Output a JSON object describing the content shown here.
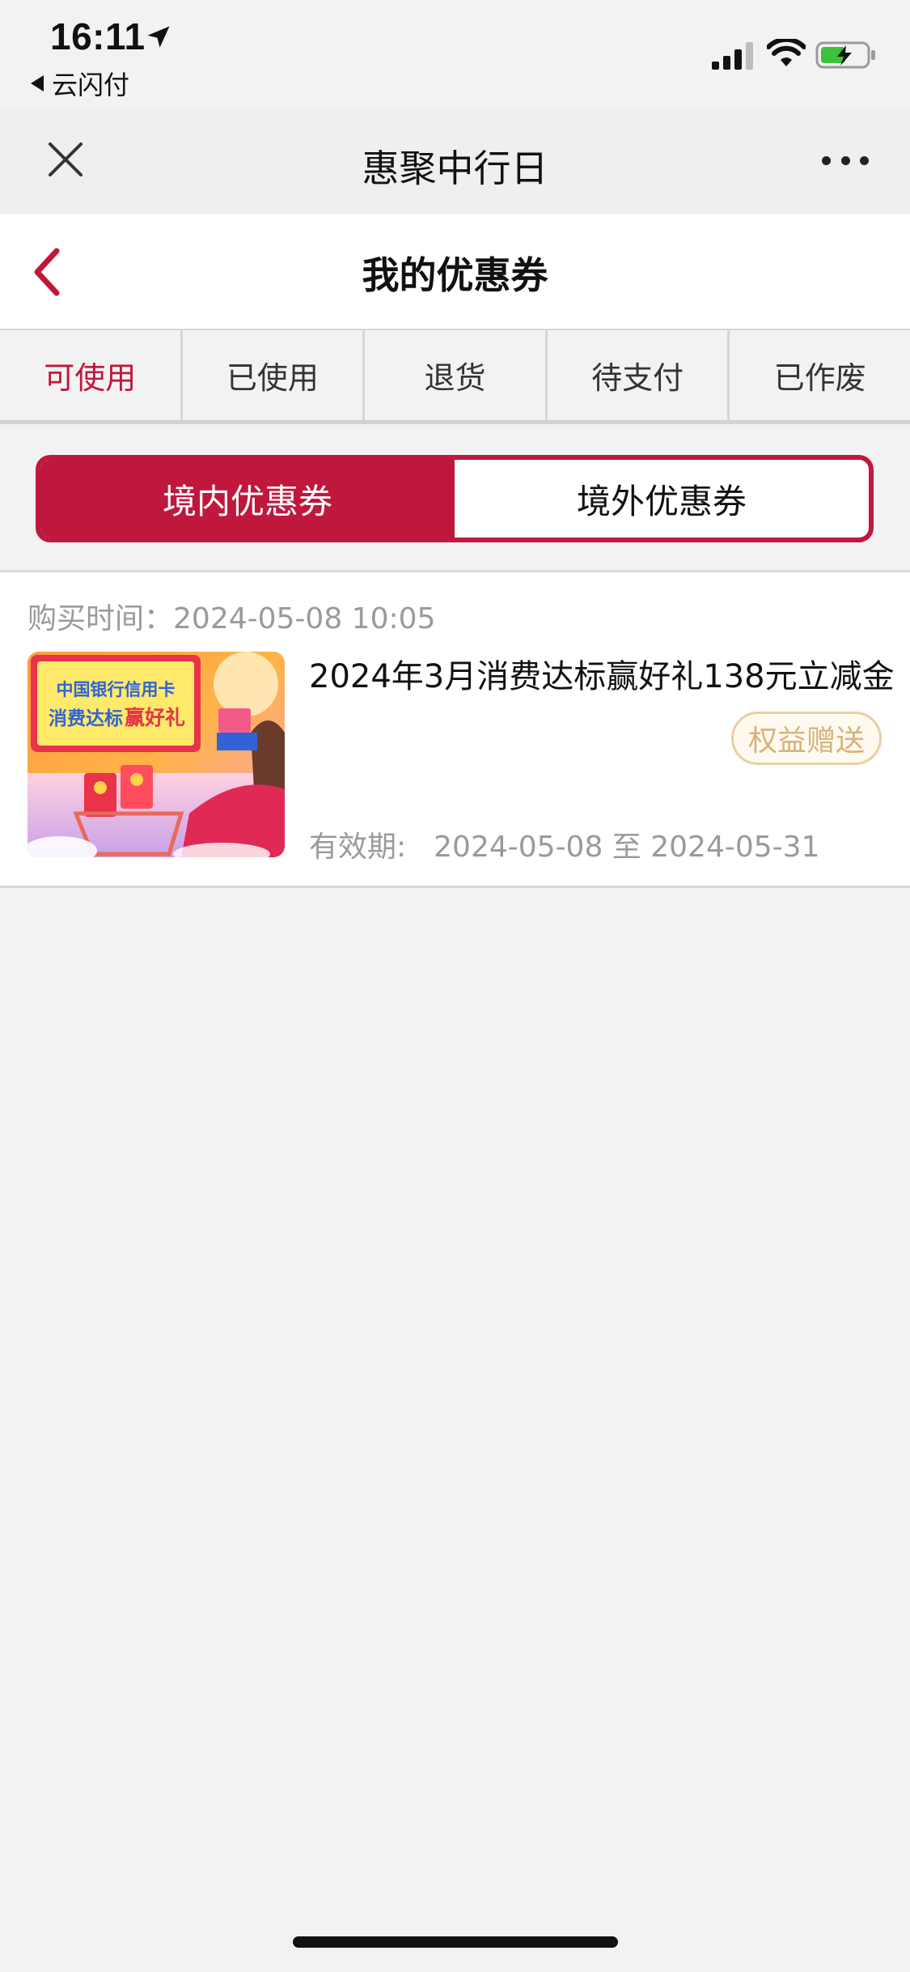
{
  "status_bar": {
    "time": "16:11",
    "back_app_label": "云闪付"
  },
  "mini_nav": {
    "title": "惠聚中行日"
  },
  "page": {
    "title": "我的优惠券"
  },
  "tabs": [
    {
      "label": "可使用",
      "active": true
    },
    {
      "label": "已使用",
      "active": false
    },
    {
      "label": "退货",
      "active": false
    },
    {
      "label": "待支付",
      "active": false
    },
    {
      "label": "已作废",
      "active": false
    }
  ],
  "segment": {
    "domestic": "境内优惠券",
    "overseas": "境外优惠券"
  },
  "coupon": {
    "purchase_label": "购买时间：",
    "purchase_time": "2024-05-08 10:05",
    "title": "2024年3月消费达标赢好礼138元立减金",
    "badge": "权益赠送",
    "validity_label": "有效期:",
    "validity_range": "2024-05-08 至 2024-05-31",
    "image": {
      "line1": "中国银行信用卡",
      "line2a": "消费达标",
      "line2b": "赢好礼"
    }
  },
  "colors": {
    "accent": "#c0183d",
    "badge_text": "#d8b27a",
    "badge_border": "#e8cfa3",
    "muted_text": "#9a9a9a"
  }
}
